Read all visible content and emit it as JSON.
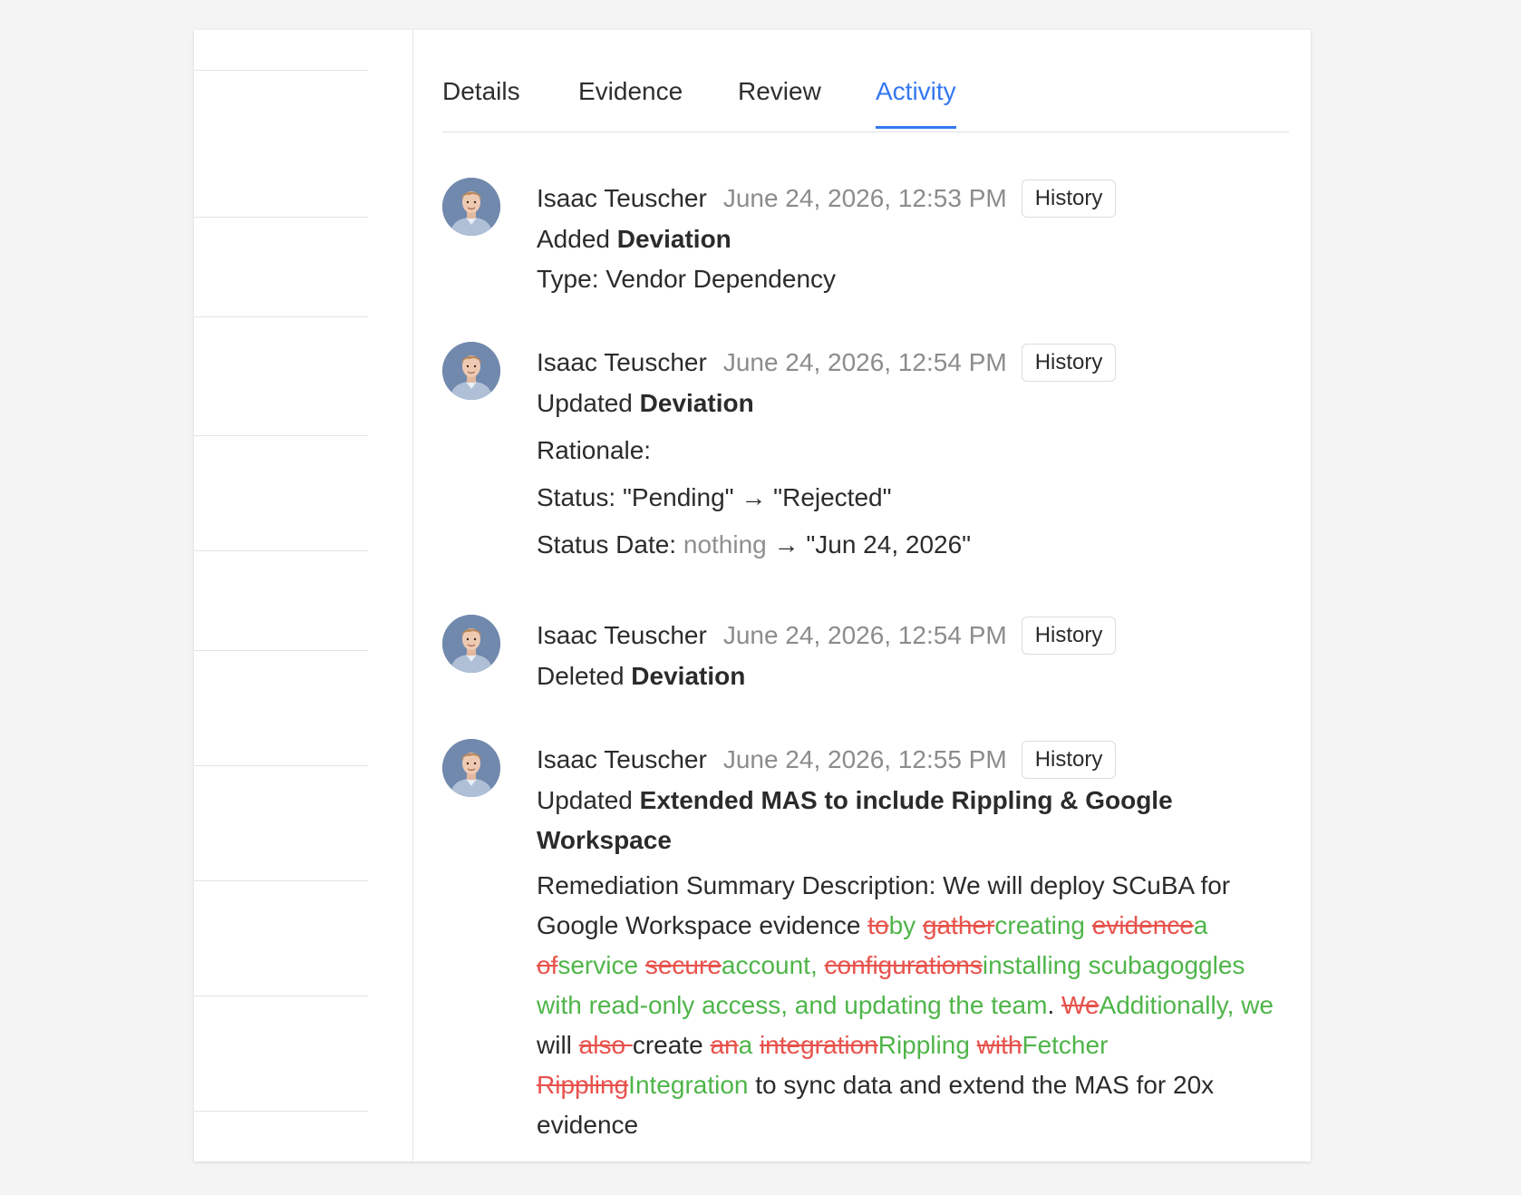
{
  "tabs": [
    "Details",
    "Evidence",
    "Review",
    "Activity"
  ],
  "active_tab": "Activity",
  "history_label": "History",
  "entries": [
    {
      "author": "Isaac Teuscher",
      "time": "June 24, 2026, 12:53 PM",
      "action": "Added",
      "target": "Deviation",
      "details": [
        "Type: Vendor Dependency"
      ]
    },
    {
      "author": "Isaac Teuscher",
      "time": "June 24, 2026, 12:54 PM",
      "action": "Updated",
      "target": "Deviation",
      "changes": {
        "rationale_label": "Rationale:",
        "status_label": "Status:",
        "status_from": "\"Pending\"",
        "status_to": "\"Rejected\"",
        "status_date_label": "Status Date:",
        "status_date_from": "nothing",
        "status_date_to": "\"Jun 24, 2026\"",
        "arrow": "→"
      }
    },
    {
      "author": "Isaac Teuscher",
      "time": "June 24, 2026, 12:54 PM",
      "action": "Deleted",
      "target": "Deviation"
    },
    {
      "author": "Isaac Teuscher",
      "time": "June 24, 2026, 12:55 PM",
      "action": "Updated",
      "target": "Extended MAS to include Rippling & Google Workspace",
      "field_label": "Remediation Summary Description:",
      "diff": [
        {
          "t": "same",
          "s": " We will deploy SCuBA for Google Workspace evidence "
        },
        {
          "t": "del",
          "s": "to"
        },
        {
          "t": "ins",
          "s": "by"
        },
        {
          "t": "same",
          "s": " "
        },
        {
          "t": "del",
          "s": "gather"
        },
        {
          "t": "ins",
          "s": "creating"
        },
        {
          "t": "same",
          "s": " "
        },
        {
          "t": "del",
          "s": "evidence"
        },
        {
          "t": "ins",
          "s": "a"
        },
        {
          "t": "same",
          "s": " "
        },
        {
          "t": "del",
          "s": "of"
        },
        {
          "t": "ins",
          "s": "service"
        },
        {
          "t": "same",
          "s": " "
        },
        {
          "t": "del",
          "s": "secure"
        },
        {
          "t": "ins",
          "s": "account,"
        },
        {
          "t": "same",
          "s": " "
        },
        {
          "t": "del",
          "s": "configurations"
        },
        {
          "t": "ins",
          "s": "installing scubagoggles with read-only access, and updating the team"
        },
        {
          "t": "same",
          "s": ". "
        },
        {
          "t": "del",
          "s": "We"
        },
        {
          "t": "ins",
          "s": "Additionally, we"
        },
        {
          "t": "same",
          "s": " will "
        },
        {
          "t": "del",
          "s": "also "
        },
        {
          "t": "same",
          "s": "create "
        },
        {
          "t": "del",
          "s": "an"
        },
        {
          "t": "ins",
          "s": "a"
        },
        {
          "t": "same",
          "s": " "
        },
        {
          "t": "del",
          "s": "integration"
        },
        {
          "t": "ins",
          "s": "Rippling"
        },
        {
          "t": "same",
          "s": " "
        },
        {
          "t": "del",
          "s": "with"
        },
        {
          "t": "ins",
          "s": "Fetcher"
        },
        {
          "t": "same",
          "s": " "
        },
        {
          "t": "del",
          "s": "Rippling"
        },
        {
          "t": "ins",
          "s": "Integration"
        },
        {
          "t": "same",
          "s": " to sync data and extend the MAS for 20x evidence"
        }
      ]
    }
  ],
  "colors": {
    "accent": "#3478f0",
    "deleted": "#e8524c",
    "inserted": "#4fb54a",
    "muted": "#8c8c8c"
  }
}
